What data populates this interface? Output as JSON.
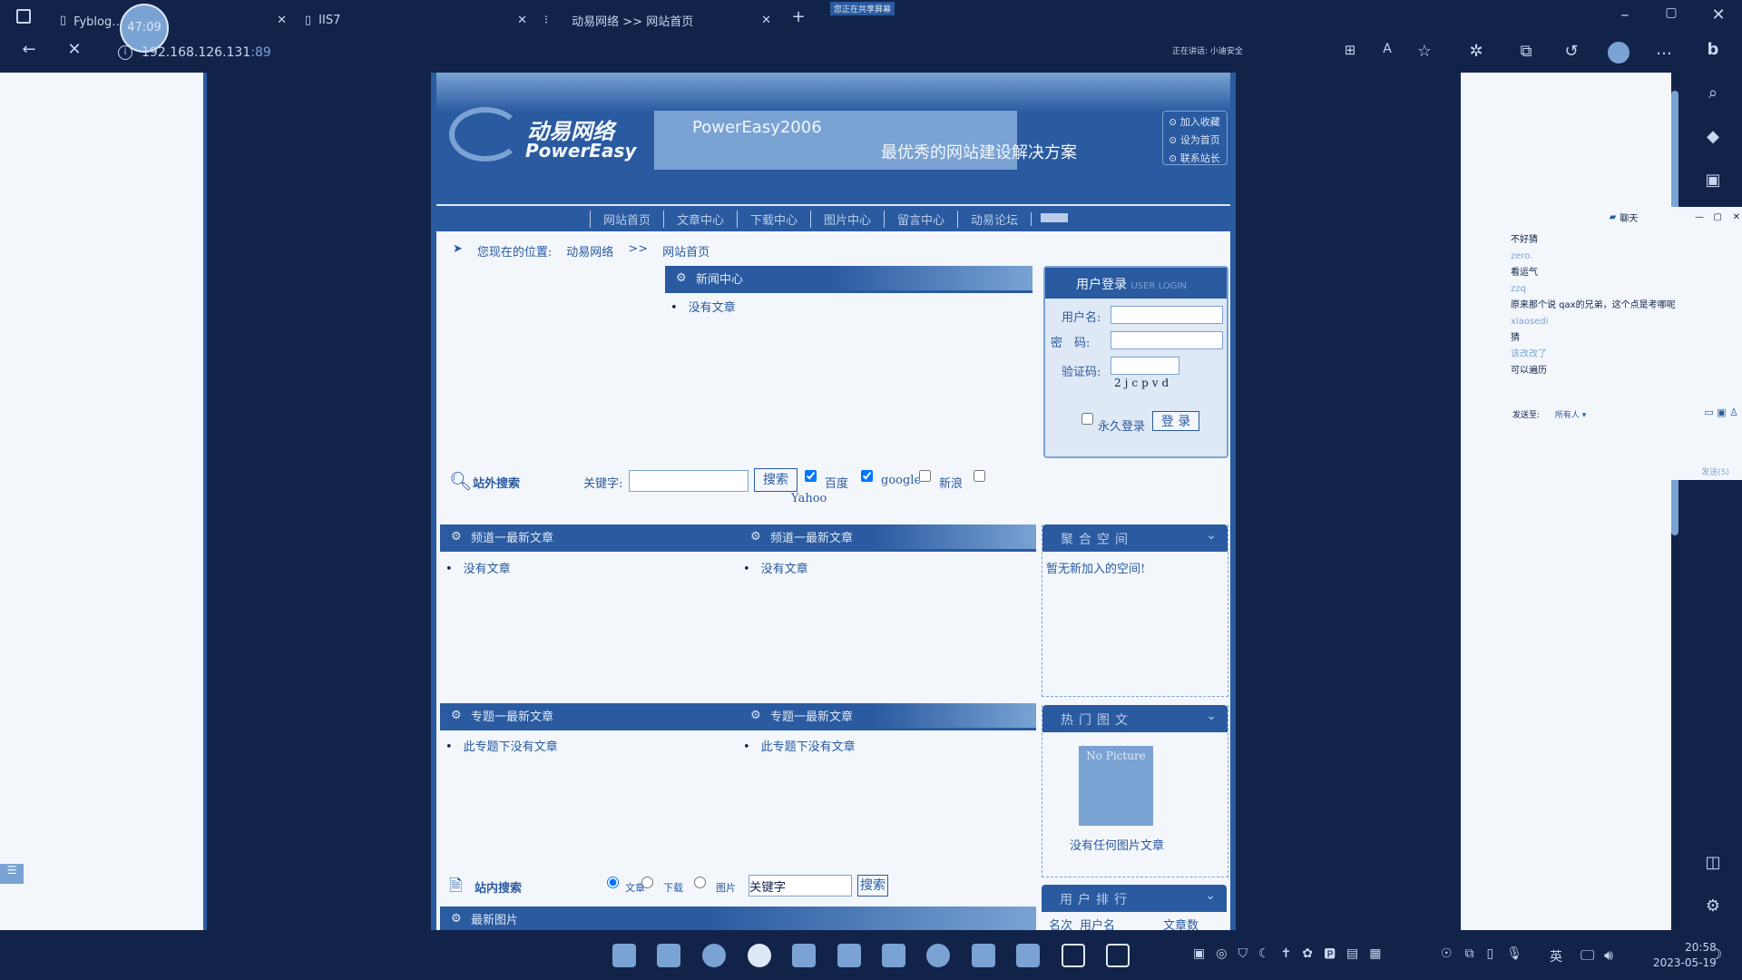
{
  "browser": {
    "tabs": [
      {
        "label": "Fyblog…章系统"
      },
      {
        "label": "IIS7"
      },
      {
        "label": "动易网络 >> 网站首页"
      }
    ],
    "timer_badge": "47:09",
    "sharing_badge": "您正在共享屏幕",
    "address": "192.168.126.131",
    "address_port": ":89",
    "speaking": "正在讲话: 小迪安全"
  },
  "site": {
    "logo_cn": "动易网络",
    "logo_en": "PowerEasy",
    "banner_brand": "PowerEasy2006",
    "banner_slogan": "最优秀的网站建设解决方案",
    "quick_links": [
      "加入收藏",
      "设为首页",
      "联系站长"
    ],
    "nav": [
      "网站首页",
      "文章中心",
      "下载中心",
      "图片中心",
      "留言中心",
      "动易论坛"
    ],
    "breadcrumb": {
      "label": "您现在的位置:",
      "site": "动易网络",
      "sep": ">>",
      "page": "网站首页"
    },
    "news": {
      "title": "新闻中心",
      "items": [
        "没有文章"
      ]
    },
    "login": {
      "title": "用户登录",
      "title_en": "USER LOGIN",
      "username_label": "用户名:",
      "password_label": "密　码:",
      "captcha_label": "验证码:",
      "captcha": "2jcpvd",
      "remember": "永久登录",
      "submit": "登 录"
    },
    "ext_search": {
      "title": "站外搜索",
      "keyword_label": "关键字:",
      "button": "搜索",
      "engines": [
        {
          "label": "百度",
          "checked": true
        },
        {
          "label": "google",
          "checked": true
        },
        {
          "label": "新浪",
          "checked": false
        },
        {
          "label": "Yahoo",
          "checked": false
        }
      ]
    },
    "channels": [
      {
        "title": "频道一最新文章",
        "items": [
          "没有文章"
        ]
      },
      {
        "title": "频道一最新文章",
        "items": [
          "没有文章"
        ]
      }
    ],
    "specials": [
      {
        "title": "专题一最新文章",
        "items": [
          "此专题下没有文章"
        ]
      },
      {
        "title": "专题一最新文章",
        "items": [
          "此专题下没有文章"
        ]
      }
    ],
    "space": {
      "title": "聚合空间",
      "empty": "暂无新加入的空间!"
    },
    "hot_pics": {
      "title": "热门图文",
      "placeholder": "No Picture",
      "empty": "没有任何图片文章"
    },
    "site_search": {
      "title": "站内搜索",
      "options": [
        {
          "label": "文章",
          "checked": true
        },
        {
          "label": "下载",
          "checked": false
        },
        {
          "label": "图片",
          "checked": false
        }
      ],
      "keyword": "关键字",
      "button": "搜索"
    },
    "user_rank": {
      "title": "用户排行",
      "columns": [
        "名次",
        "用户名",
        "文章数"
      ]
    },
    "latest_pics": {
      "title": "最新图片"
    }
  },
  "chat": {
    "title": "聊天",
    "messages": [
      {
        "text": "不好猜"
      },
      {
        "name": "zero."
      },
      {
        "text": "看运气"
      },
      {
        "name": "zzq"
      },
      {
        "text": "原来那个说 qax的兄弟，这个点是考哪呢"
      },
      {
        "name": "xiaosedi"
      },
      {
        "text": "猜"
      },
      {
        "name": "该改改了"
      },
      {
        "text": "可以遍历"
      }
    ],
    "send_to_label": "发送至:",
    "send_to": "所有人",
    "send": "发送(S)"
  },
  "taskbar": {
    "time": "20:58",
    "date": "2023-05-19",
    "ime": "英"
  }
}
